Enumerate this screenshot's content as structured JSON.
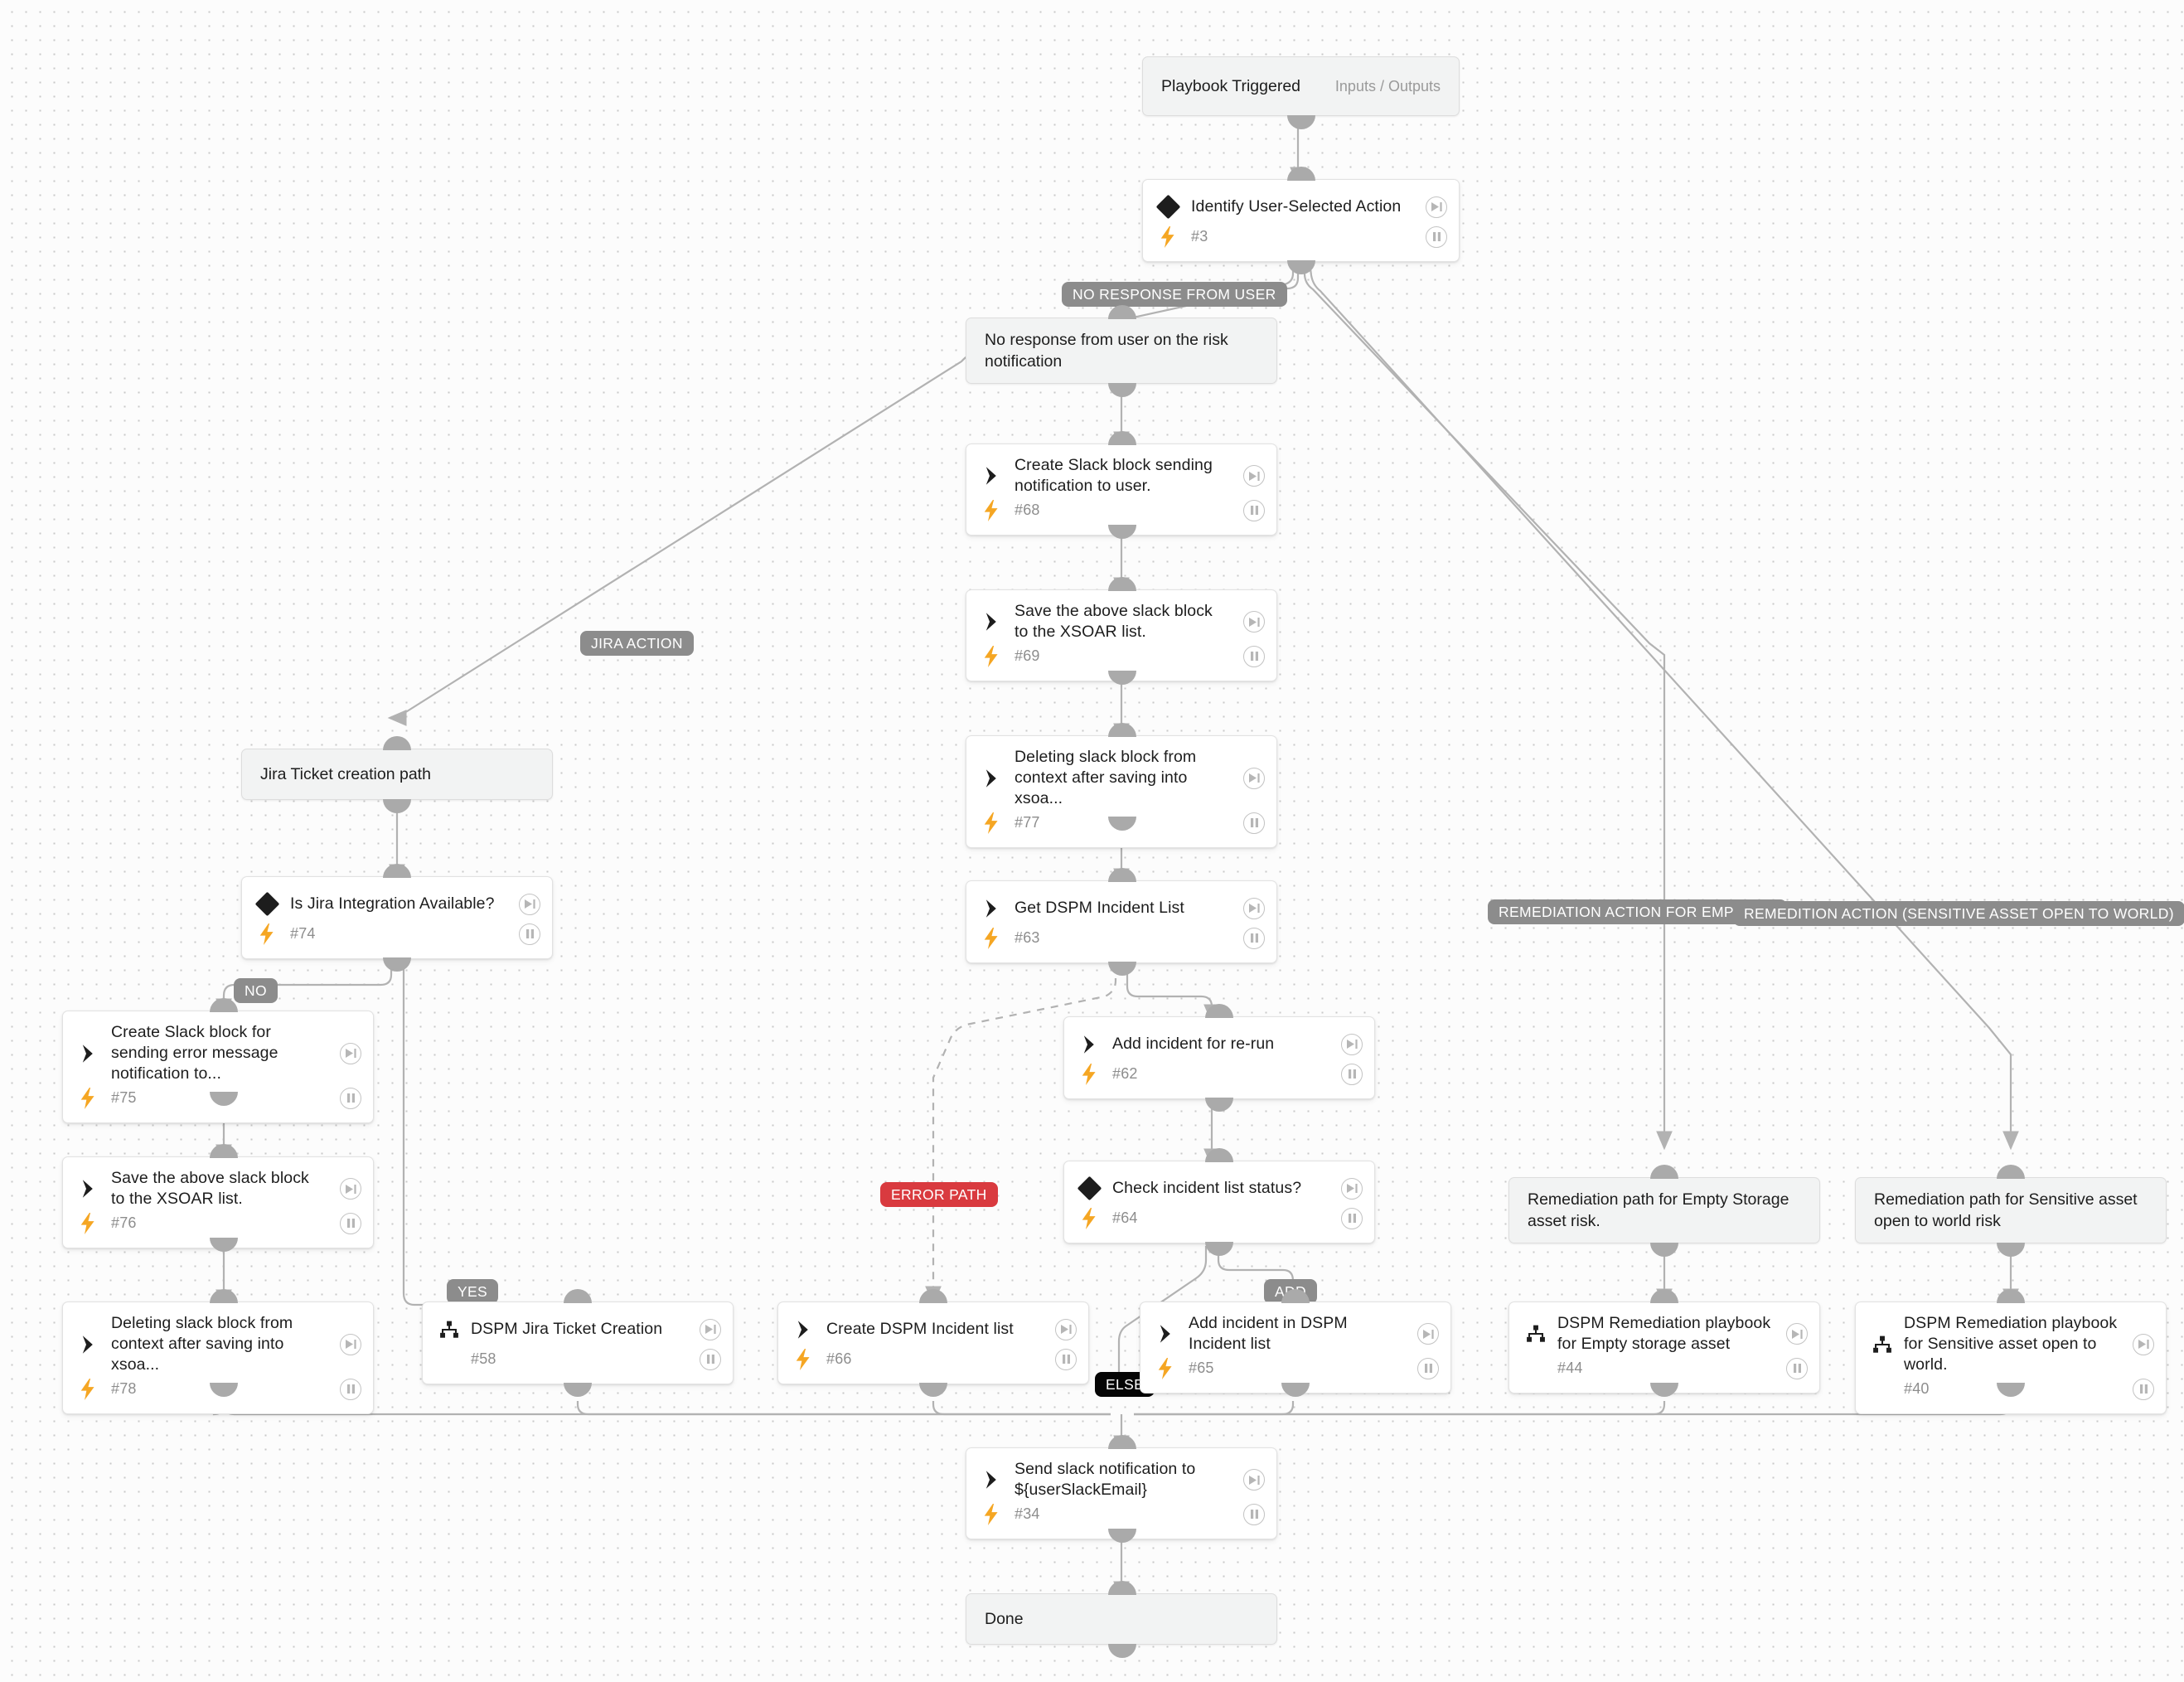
{
  "canvas": {
    "background_color": "#fcfcfc",
    "grid_dot_color": "#c9c9c9"
  },
  "colors": {
    "card_background": "#ffffff",
    "section_background": "#f2f3f3",
    "bolt_accent": "#f5a623",
    "edge": "#b2b2b2",
    "pill_default": "#8c8c8c",
    "pill_error": "#d93a3f",
    "pill_else": "#050505",
    "text": "#1d1d1d",
    "muted_text": "#8d8d8d"
  },
  "nodes": {
    "start": {
      "title": "Playbook Triggered",
      "sub": "Inputs / Outputs"
    },
    "n3": {
      "title": "Identify User-Selected Action",
      "id": "#3",
      "glyph": "condition"
    },
    "no_response_label": {
      "title": "No response from user on the risk notification"
    },
    "n68": {
      "title": "Create Slack block sending notification to user.",
      "id": "#68",
      "glyph": "task"
    },
    "n69": {
      "title": "Save the above slack block to the XSOAR list.",
      "id": "#69",
      "glyph": "task"
    },
    "n77": {
      "title": "Deleting slack block from context after saving into xsoa...",
      "id": "#77",
      "glyph": "task"
    },
    "n63": {
      "title": "Get DSPM Incident List",
      "id": "#63",
      "glyph": "task"
    },
    "jira_label": {
      "title": "Jira Ticket creation path"
    },
    "n74": {
      "title": "Is Jira Integration Available?",
      "id": "#74",
      "glyph": "condition"
    },
    "n75": {
      "title": "Create Slack block for sending error message notification to...",
      "id": "#75",
      "glyph": "task"
    },
    "n76": {
      "title": "Save the above slack block to the XSOAR list.",
      "id": "#76",
      "glyph": "task"
    },
    "n78": {
      "title": "Deleting slack block from context after saving into xsoa...",
      "id": "#78",
      "glyph": "task"
    },
    "n58": {
      "title": "DSPM Jira Ticket Creation",
      "id": "#58",
      "glyph": "playbook"
    },
    "n62": {
      "title": "Add incident for re-run",
      "id": "#62",
      "glyph": "task"
    },
    "n64": {
      "title": "Check incident list status?",
      "id": "#64",
      "glyph": "condition"
    },
    "n66": {
      "title": "Create DSPM Incident list",
      "id": "#66",
      "glyph": "task"
    },
    "n65": {
      "title": "Add incident in DSPM Incident list",
      "id": "#65",
      "glyph": "task"
    },
    "empty_label": {
      "title": "Remediation path for Empty Storage asset risk."
    },
    "n44": {
      "title": "DSPM Remediation playbook for Empty storage asset",
      "id": "#44",
      "glyph": "playbook"
    },
    "sensitive_label": {
      "title": "Remediation path for Sensitive asset open to world risk"
    },
    "n40": {
      "title": "DSPM Remediation playbook for Sensitive asset open to world.",
      "id": "#40",
      "glyph": "playbook"
    },
    "n34": {
      "title": "Send slack notification to ${userSlackEmail}",
      "id": "#34",
      "glyph": "task"
    },
    "done": {
      "title": "Done"
    }
  },
  "edge_labels": {
    "no_response": "NO RESPONSE FROM USER",
    "jira_action": "JIRA ACTION",
    "remediation_empty": "REMEDIATION ACTION FOR EMPTY ST",
    "remediation_sensitive": "REMEDITION ACTION (SENSITIVE ASSET OPEN TO WORLD)",
    "no": "NO",
    "yes": "YES",
    "error_path": "ERROR PATH",
    "add": "ADD",
    "else": "ELSE"
  },
  "icons": {
    "condition": "diamond-icon",
    "task": "chevron-right-icon",
    "playbook": "hierarchy-icon",
    "automated": "lightning-bolt-icon",
    "run": "skip-next-icon",
    "pause": "pause-icon"
  }
}
